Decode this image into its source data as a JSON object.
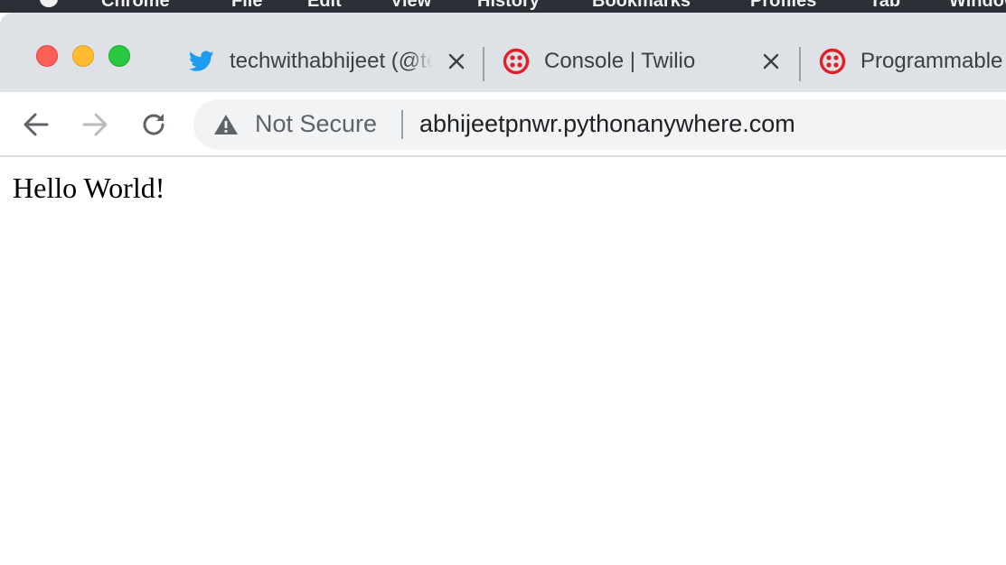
{
  "menubar": {
    "app_name": "Chrome",
    "items": [
      "File",
      "Edit",
      "View",
      "History",
      "Bookmarks",
      "Profiles",
      "Tab",
      "Window"
    ]
  },
  "tabs": [
    {
      "title": "techwithabhijeet (@techwithabhijeet) / Twitter",
      "favicon": "twitter-bird-icon",
      "has_close": true
    },
    {
      "title": "Console | Twilio",
      "favicon": "twilio-icon",
      "has_close": true
    },
    {
      "title": "Programmable",
      "favicon": "twilio-icon",
      "has_close": false
    }
  ],
  "toolbar": {
    "security_label": "Not Secure",
    "url": "abhijeetpnwr.pythonanywhere.com"
  },
  "page": {
    "body_text": "Hello World!"
  },
  "colors": {
    "tabstrip_bg": "#dee1e6",
    "twitter_blue": "#1d9bf0",
    "twilio_red": "#e31e26",
    "omnibox_bg": "#f1f3f4"
  }
}
